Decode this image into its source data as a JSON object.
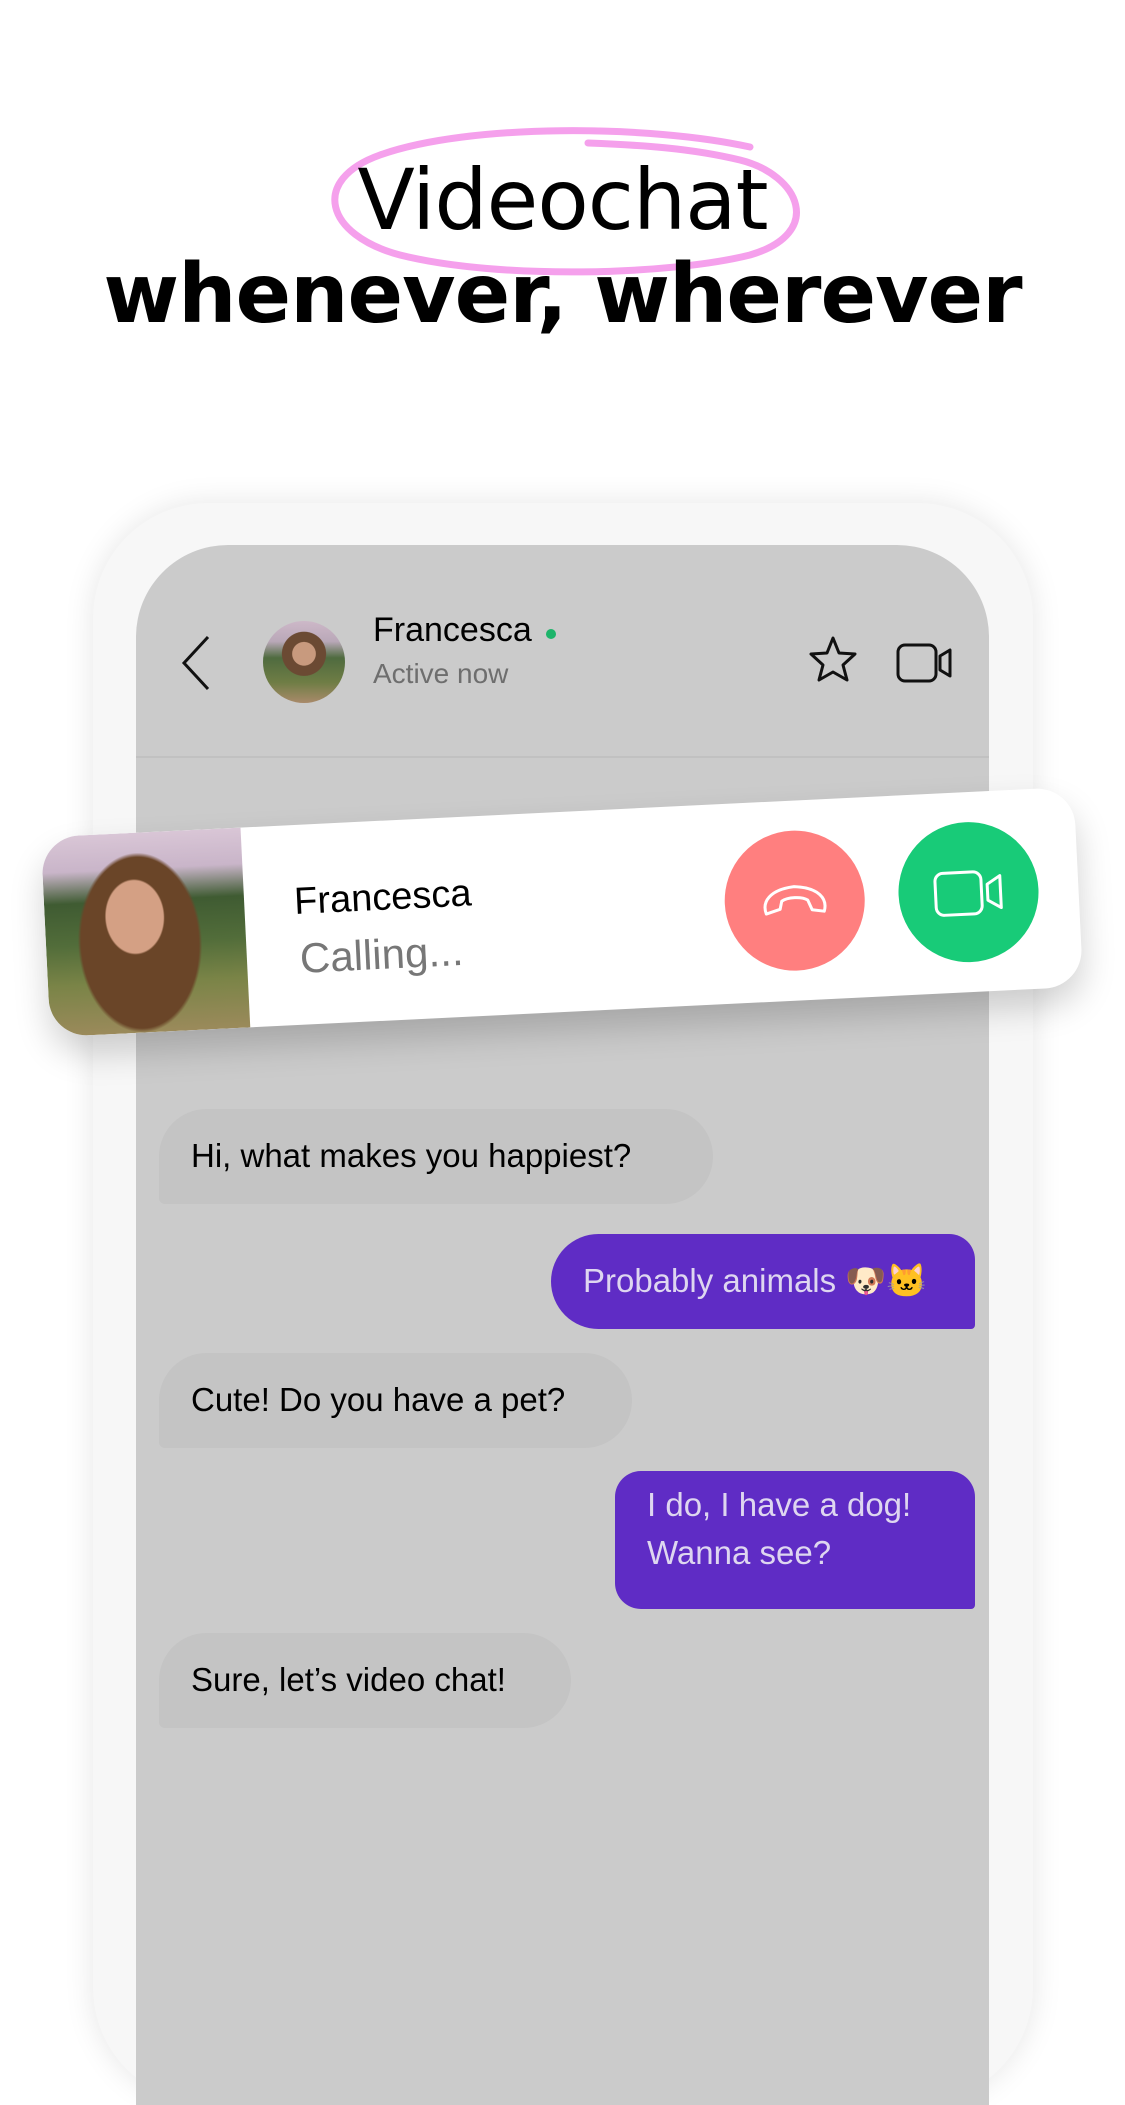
{
  "headline": {
    "highlighted_word": "Videochat",
    "line2": "whenever, wherever",
    "scribble_color": "#F5A0EC"
  },
  "chat": {
    "header": {
      "back_icon": "chevron-left-icon",
      "contact_name": "Francesca",
      "status": "Active now",
      "online_color": "#1DB46A",
      "actions": [
        {
          "name": "favorite",
          "icon": "star-icon"
        },
        {
          "name": "video-call",
          "icon": "video-camera-icon"
        }
      ]
    },
    "messages": [
      {
        "direction": "incoming",
        "text": "Hi, what makes you happiest?"
      },
      {
        "direction": "outgoing",
        "text": "Probably animals 🐶🐱"
      },
      {
        "direction": "incoming",
        "text": "Cute! Do you have a pet?"
      },
      {
        "direction": "outgoing",
        "lines": [
          "I do, I have a dog!",
          "Wanna see?"
        ]
      },
      {
        "direction": "incoming",
        "text": "Sure, let’s video chat!"
      }
    ],
    "colors": {
      "background": "#CBCBCB",
      "incoming_bubble": "#C4C4C4",
      "outgoing_bubble": "#5F2CC5",
      "outgoing_text": "#DED6F0"
    }
  },
  "incoming_call": {
    "caller_name": "Francesca",
    "status": "Calling...",
    "decline": {
      "icon": "phone-hangup-icon",
      "color": "#FF7F7F"
    },
    "accept": {
      "icon": "video-camera-icon",
      "color": "#18CB78"
    }
  }
}
